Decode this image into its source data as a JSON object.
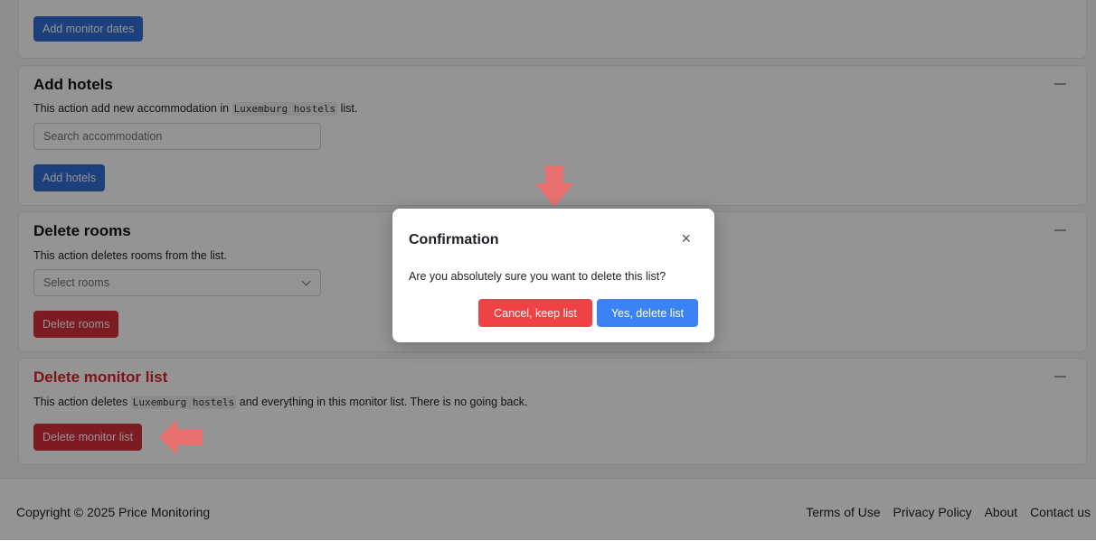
{
  "monitor_dates": {
    "button": "Add monitor dates"
  },
  "add_hotels": {
    "title": "Add hotels",
    "desc_pre": "This action add new accommodation in ",
    "list_name": "Luxemburg hostels",
    "desc_post": " list.",
    "search_placeholder": "Search accommodation",
    "button": "Add hotels"
  },
  "delete_rooms": {
    "title": "Delete rooms",
    "desc": "This action deletes rooms from the list.",
    "select_placeholder": "Select rooms",
    "button": "Delete rooms"
  },
  "delete_list": {
    "title": "Delete monitor list",
    "desc_pre": "This action deletes ",
    "list_name": "Luxemburg hostels",
    "desc_post": " and everything in this monitor list. There is no going back.",
    "button": "Delete monitor list"
  },
  "footer": {
    "copyright": "Copyright © 2025 Price Monitoring",
    "links": [
      "Terms of Use",
      "Privacy Policy",
      "About",
      "Contact us"
    ]
  },
  "modal": {
    "title": "Confirmation",
    "close": "×",
    "body": "Are you absolutely sure you want to delete this list?",
    "cancel": "Cancel, keep list",
    "confirm": "Yes, delete list"
  },
  "colors": {
    "primary": "#2f6fd6",
    "danger": "#d62f3a",
    "annotation_arrow": "#e8716f"
  }
}
